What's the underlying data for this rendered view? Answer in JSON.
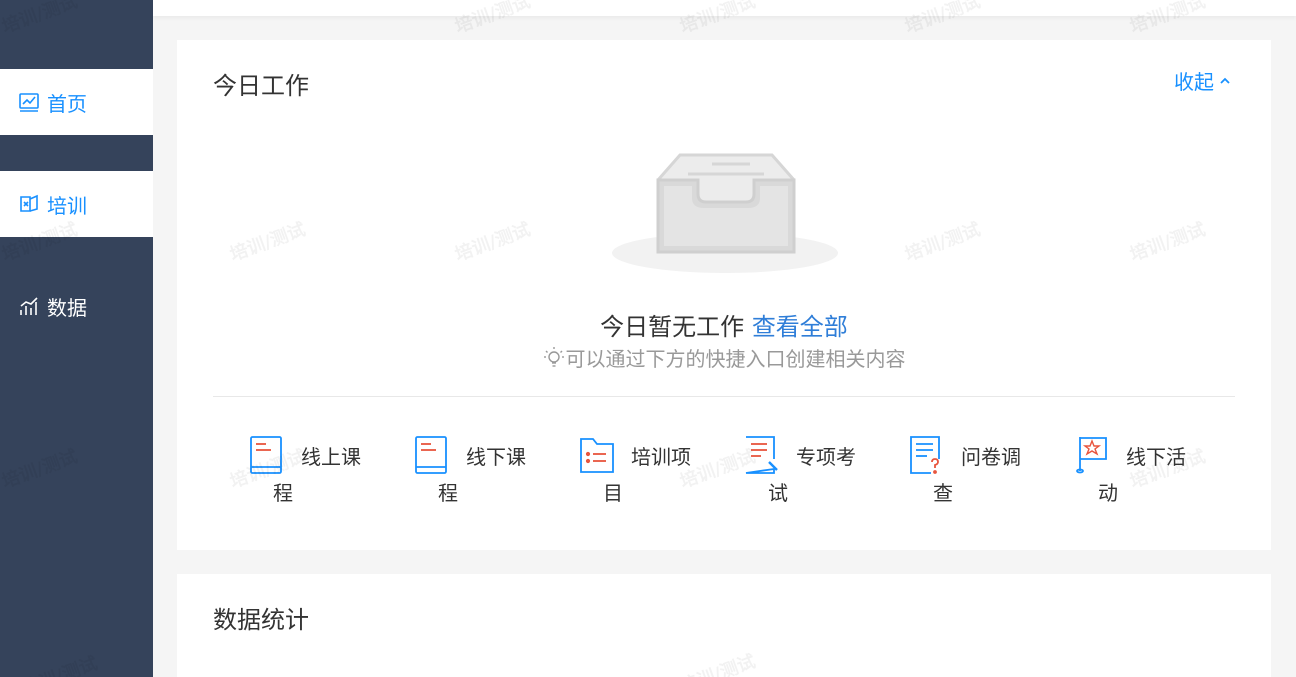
{
  "sidebar": {
    "items": [
      {
        "label": "首页",
        "icon": "dashboard-chart-icon",
        "active": true
      },
      {
        "label": "培训",
        "icon": "training-book-icon",
        "active": true
      },
      {
        "label": "数据",
        "icon": "bar-chart-icon",
        "active": false
      }
    ]
  },
  "work_card": {
    "title": "今日工作",
    "collapse_label": "收起",
    "empty_text": "今日暂无工作",
    "view_all_label": "查看全部",
    "hint_text": "可以通过下方的快捷入口创建相关内容",
    "shortcuts": [
      {
        "label": "线上课程",
        "icon": "online-course-icon"
      },
      {
        "label": "线下课程",
        "icon": "offline-course-icon"
      },
      {
        "label": "培训项目",
        "icon": "training-project-folder-icon"
      },
      {
        "label": "专项考试",
        "icon": "exam-paper-icon"
      },
      {
        "label": "问卷调查",
        "icon": "survey-question-icon"
      },
      {
        "label": "线下活动",
        "icon": "activity-flag-icon"
      }
    ]
  },
  "stats_card": {
    "title": "数据统计"
  },
  "watermark_text": "培训/测试",
  "colors": {
    "sidebar_bg": "#35435b",
    "accent": "#1890ff",
    "link": "#2f7ed8",
    "icon_red": "#e8553e"
  }
}
